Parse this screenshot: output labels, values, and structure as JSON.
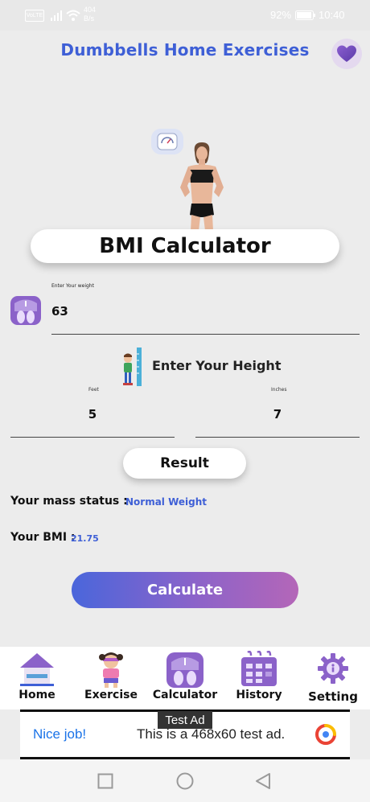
{
  "status_bar": {
    "network_label": "VoLTE",
    "speed_value": "404",
    "speed_unit": "B/s",
    "battery": "92%",
    "time": "10:40"
  },
  "header": {
    "title": "Dumbbells Home Exercises",
    "favorite_icon": "heart-icon"
  },
  "calculator": {
    "title": "BMI Calculator",
    "weight": {
      "label": "Enter Your weight",
      "value": "63"
    },
    "height": {
      "heading": "Enter Your Height",
      "feet_label": "Feet",
      "feet_value": "5",
      "inches_label": "Inches",
      "inches_value": "7"
    },
    "result_label": "Result",
    "mass_status_label": "Your mass status :",
    "mass_status_value": "Normal Weight",
    "bmi_label": "Your BMI :",
    "bmi_value": "21.75",
    "calculate_label": "Calculate"
  },
  "bottom_nav": {
    "items": [
      {
        "label": "Home",
        "icon": "house-icon"
      },
      {
        "label": "Exercise",
        "icon": "girl-exercise-icon"
      },
      {
        "label": "Calculator",
        "icon": "scale-icon"
      },
      {
        "label": "History",
        "icon": "calendar-icon"
      },
      {
        "label": "Setting",
        "icon": "gear-icon"
      }
    ]
  },
  "ad": {
    "tag": "Test Ad",
    "headline": "Nice job!",
    "body": "This is a 468x60 test ad."
  },
  "colors": {
    "accent": "#3e5fd6",
    "gradient_start": "#4a66db",
    "gradient_end": "#b466b8",
    "background": "#ececec"
  }
}
